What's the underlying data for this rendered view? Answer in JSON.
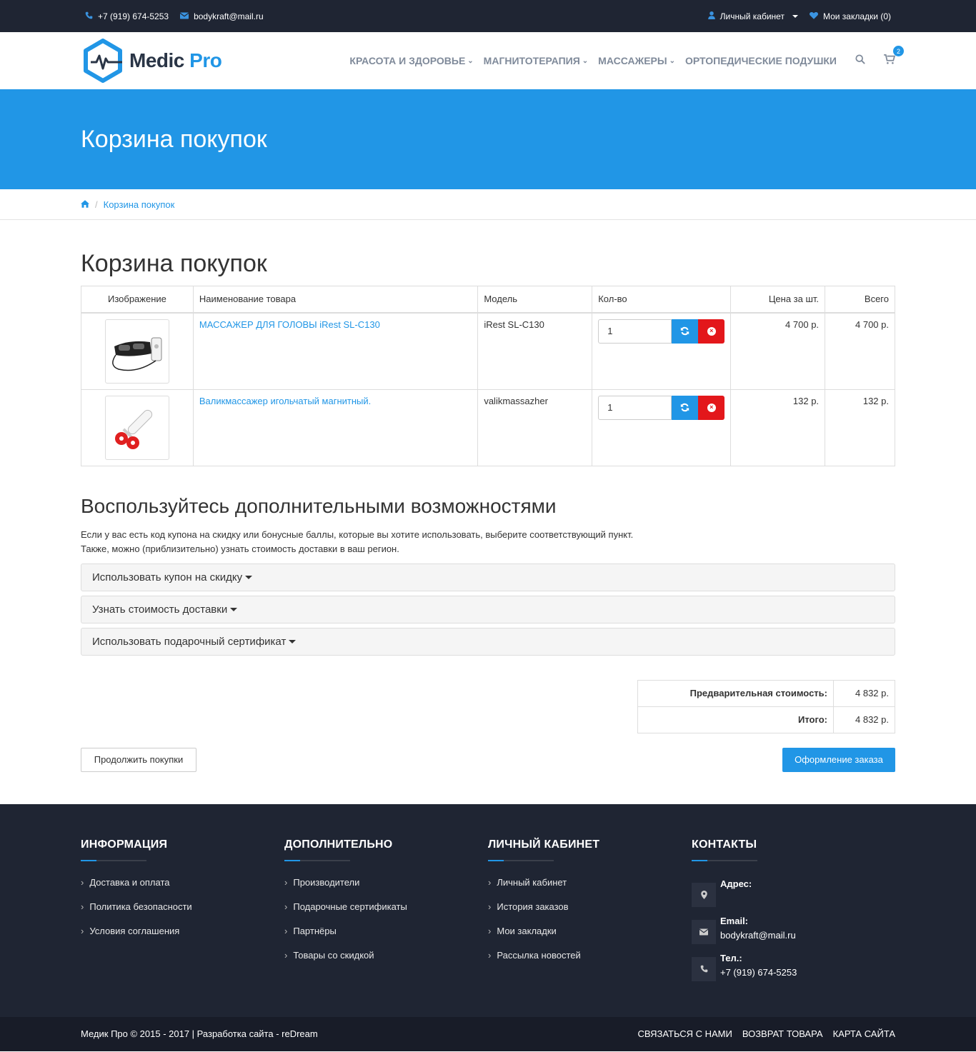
{
  "topbar": {
    "phone": "+7 (919) 674-5253",
    "email": "bodykraft@mail.ru",
    "account": "Личный кабинет",
    "bookmarks": "Мои закладки (0)"
  },
  "logo": {
    "name": "Medic",
    "suffix": "Pro"
  },
  "nav": {
    "items": [
      {
        "label": "КРАСОТА И ЗДОРОВЬЕ",
        "chevron": "⌄"
      },
      {
        "label": "МАГНИТОТЕРАПИЯ",
        "chevron": "⌄"
      },
      {
        "label": "МАССАЖЕРЫ",
        "chevron": "⌄"
      },
      {
        "label": "ОРТОПЕДИЧЕСКИЕ ПОДУШКИ",
        "chevron": ""
      }
    ],
    "cart_count": "2"
  },
  "banner": {
    "title": "Корзина покупок"
  },
  "breadcrumb": {
    "separator": "/",
    "current": "Корзина покупок"
  },
  "cart": {
    "title": "Корзина покупок",
    "headers": {
      "image": "Изображение",
      "name": "Наименование товара",
      "model": "Модель",
      "qty": "Кол-во",
      "price": "Цена за шт.",
      "total": "Всего"
    },
    "rows": [
      {
        "name": "МАССАЖЕР ДЛЯ ГОЛОВЫ iRest SL-C130",
        "model": "iRest SL-C130",
        "qty": "1",
        "price": "4 700 р.",
        "total": "4 700 р."
      },
      {
        "name": "Валикмассажер игольчатый магнитный.",
        "model": "valikmassazher",
        "qty": "1",
        "price": "132 р.",
        "total": "132 р."
      }
    ]
  },
  "extras": {
    "title": "Воспользуйтесь дополнительными возможностями",
    "text1": "Если у вас есть код купона на скидку или бонусные баллы, которые вы хотите использовать, выберите соответствующий пункт.",
    "text2": "Также, можно (приблизительно) узнать стоимость доставки в ваш регион.",
    "panels": [
      "Использовать купон на скидку",
      "Узнать стоимость доставки",
      "Использовать подарочный сертификат"
    ]
  },
  "totals": {
    "subtotal_label": "Предварительная стоимость:",
    "subtotal": "4 832 р.",
    "total_label": "Итого:",
    "total": "4 832 р."
  },
  "buttons": {
    "continue": "Продолжить покупки",
    "checkout": "Оформление заказа"
  },
  "footer": {
    "info": {
      "title": "ИНФОРМАЦИЯ",
      "links": [
        "Доставка и оплата",
        "Политика безопасности",
        "Условия соглашения"
      ]
    },
    "extra": {
      "title": "ДОПОЛНИТЕЛЬНО",
      "links": [
        "Производители",
        "Подарочные сертификаты",
        "Партнёры",
        "Товары со скидкой"
      ]
    },
    "account": {
      "title": "ЛИЧНЫЙ КАБИНЕТ",
      "links": [
        "Личный кабинет",
        "История заказов",
        "Мои закладки",
        "Рассылка новостей"
      ]
    },
    "contacts": {
      "title": "КОНТАКТЫ",
      "address_label": "Адрес:",
      "email_label": "Email:",
      "email": "bodykraft@mail.ru",
      "phone_label": "Тел.:",
      "phone": "+7 (919) 674-5253"
    }
  },
  "copyright": {
    "text": "Медик Про © 2015 - 2017 | Разработка сайта - reDream",
    "links": [
      "СВЯЗАТЬСЯ С НАМИ",
      "ВОЗВРАТ ТОВАРА",
      "КАРТА САЙТА"
    ]
  },
  "colors": {
    "accent": "#2196e6",
    "dark": "#1f2533",
    "danger": "#e3171b"
  }
}
